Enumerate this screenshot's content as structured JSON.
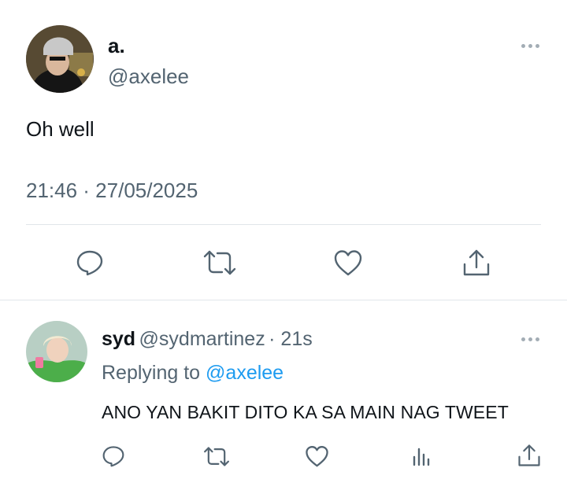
{
  "tweet": {
    "display_name": "a.",
    "handle": "@axelee",
    "text": "Oh well",
    "timestamp": "21:46 · 27/05/2025",
    "actions": [
      "reply-icon",
      "retweet-icon",
      "like-icon",
      "share-icon"
    ]
  },
  "reply": {
    "display_name": "syd",
    "handle": "@sydmartinez",
    "age": "· 21s",
    "replying_prefix": "Replying to",
    "replying_to": "@axelee",
    "text": "ANO YAN BAKIT DITO KA SA MAIN NAG TWEET",
    "actions": [
      "reply-icon",
      "retweet-icon",
      "like-icon",
      "views-icon",
      "share-icon"
    ]
  },
  "colors": {
    "text": "#0f1419",
    "secondary": "#536471",
    "accent": "#1d9bf0",
    "divider": "#e1e6ea"
  }
}
